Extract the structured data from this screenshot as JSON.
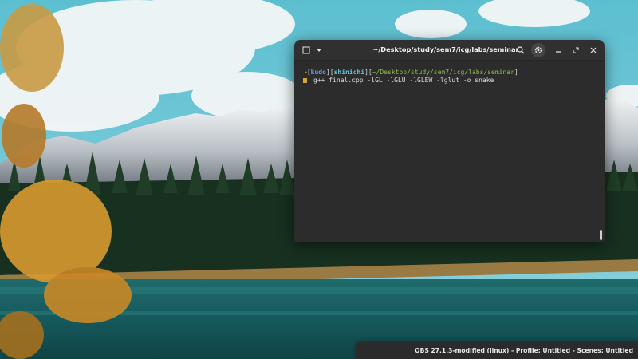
{
  "terminal": {
    "title": "~/Desktop/study/sem7/icg/labs/seminar",
    "prompt": {
      "corner": "┌",
      "user": "kudo",
      "host": "shinichi",
      "path": "~/Desktop/study/sem7/icg/labs/seminar"
    },
    "command": "g++ final.cpp -lGL -lGLU -lGLEW -lglut -o snake",
    "icons": {
      "new_tab": "new-tab-icon",
      "menu": "chevron-down-icon",
      "search": "search-icon",
      "settings": "gear-icon",
      "minimize": "minimize-icon",
      "maximize": "maximize-icon",
      "close": "close-icon"
    }
  },
  "obs": {
    "status": "OBS 27.1.3-modified (linux) - Profile: Untitled - Scenes: Untitled"
  },
  "colors": {
    "terminal_bg": "#2c2c2c",
    "prompt_user": "#6d9de8",
    "prompt_host": "#5fc6d6",
    "prompt_path": "#8fbf43",
    "prompt_accent": "#d7a43c"
  }
}
